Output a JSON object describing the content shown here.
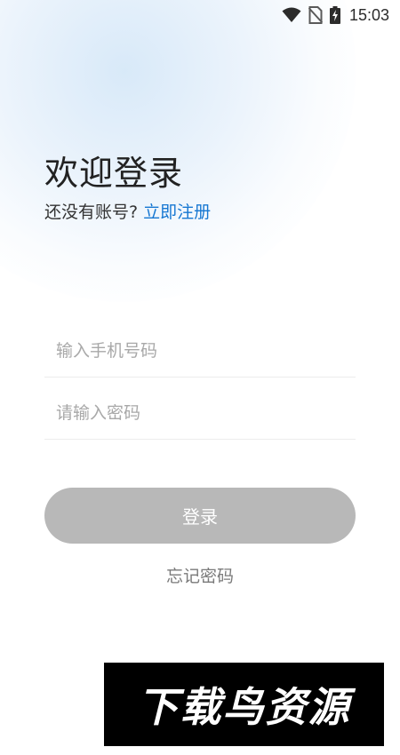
{
  "status_bar": {
    "time": "15:03",
    "icons": [
      "wifi-icon",
      "no-sim-icon",
      "battery-charging-icon"
    ]
  },
  "header": {
    "title": "欢迎登录",
    "no_account_text": "还没有账号?",
    "register_link": "立即注册"
  },
  "form": {
    "phone_placeholder": "输入手机号码",
    "password_placeholder": "请输入密码",
    "login_label": "登录",
    "forgot_label": "忘记密码"
  },
  "watermark": {
    "text": "下载鸟资源"
  },
  "colors": {
    "accent": "#1677d2",
    "button_disabled": "#b8b8b8"
  }
}
